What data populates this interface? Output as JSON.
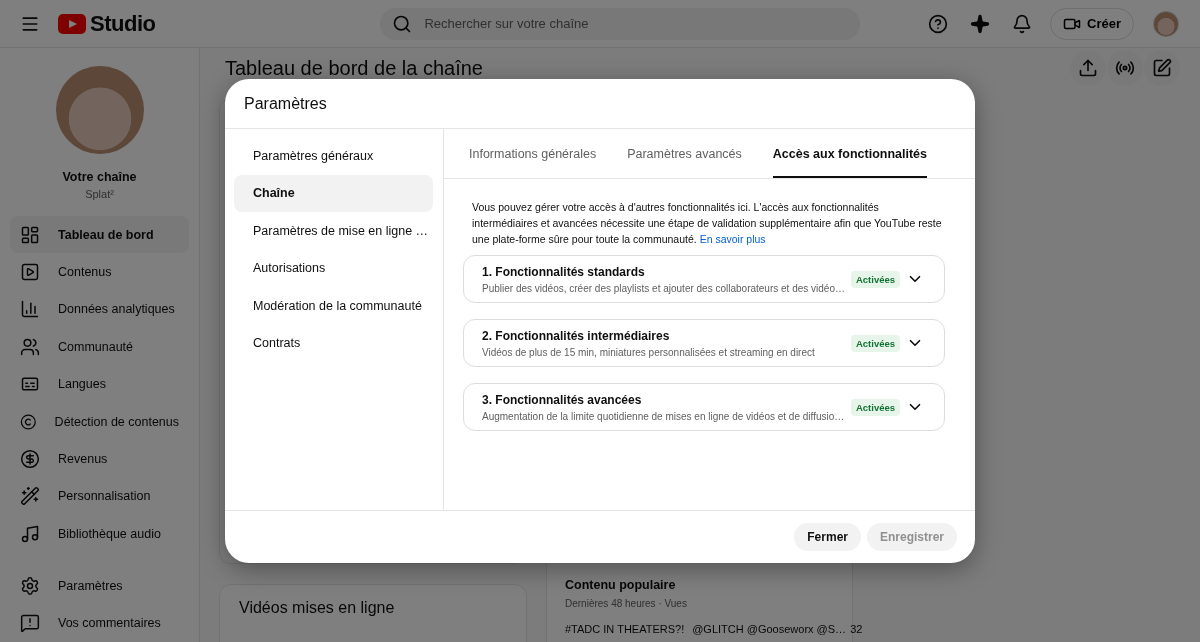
{
  "header": {
    "logo_text": "Studio",
    "search": {
      "placeholder": "Rechercher sur votre chaîne"
    },
    "create_button": "Créer"
  },
  "sidebar": {
    "channel_title": "Votre chaîne",
    "channel_name": "Splat²",
    "items": [
      {
        "label": "Tableau de bord",
        "selected": true
      },
      {
        "label": "Contenus",
        "selected": false
      },
      {
        "label": "Données analytiques",
        "selected": false
      },
      {
        "label": "Communauté",
        "selected": false
      },
      {
        "label": "Langues",
        "selected": false
      },
      {
        "label": "Détection de contenus",
        "selected": false
      },
      {
        "label": "Revenus",
        "selected": false
      },
      {
        "label": "Personnalisation",
        "selected": false
      },
      {
        "label": "Bibliothèque audio",
        "selected": false
      }
    ],
    "bottom_items": [
      {
        "label": "Paramètres",
        "selected": false
      },
      {
        "label": "Vos commentaires",
        "selected": false
      }
    ]
  },
  "main": {
    "title": "Tableau de bord de la chaîne",
    "uploads_card": {
      "title": "Vidéos mises en ligne"
    },
    "popular_card": {
      "title": "Contenu populaire",
      "subtitle": "Dernières 48 heures · Vues",
      "rows": [
        {
          "title_start": "#TADC IN THEATERS?!",
          "title_end": "@GLITCH @Gooseworx @S…",
          "views": "32"
        }
      ]
    }
  },
  "dialog": {
    "title": "Paramètres",
    "nav": [
      {
        "label": "Paramètres généraux",
        "selected": false
      },
      {
        "label": "Chaîne",
        "selected": true
      },
      {
        "label": "Paramètres de mise en ligne …",
        "selected": false
      },
      {
        "label": "Autorisations",
        "selected": false
      },
      {
        "label": "Modération de la communauté",
        "selected": false
      },
      {
        "label": "Contrats",
        "selected": false
      }
    ],
    "tabs": [
      {
        "label": "Informations générales",
        "selected": false
      },
      {
        "label": "Paramètres avancés",
        "selected": false
      },
      {
        "label": "Accès aux fonctionnalités",
        "selected": true
      }
    ],
    "intro": "Vous pouvez gérer votre accès à d'autres fonctionnalités ici. L'accès aux fonctionnalités intermédiaires et avancées nécessite une étape de validation supplémentaire afin que YouTube reste une plate-forme sûre pour toute la communauté.",
    "learn_more": "En savoir plus",
    "features": [
      {
        "title": "1. Fonctionnalités standards",
        "description": "Publier des vidéos, créer des playlists et ajouter des collaborateurs et des vidéo…",
        "status": "Activées",
        "expanded": false
      },
      {
        "title": "2. Fonctionnalités intermédiaires",
        "description": "Vidéos de plus de 15 min, miniatures personnalisées et streaming en direct",
        "status": "Activées",
        "expanded": false
      },
      {
        "title": "3. Fonctionnalités avancées",
        "description": "Augmentation de la limite quotidienne de mises en ligne de vidéos et de diffusio…",
        "status": "Activées",
        "expanded": false
      }
    ],
    "buttons": [
      {
        "label": "Fermer",
        "disabled": false
      },
      {
        "label": "Enregistrer",
        "disabled": true
      }
    ]
  }
}
